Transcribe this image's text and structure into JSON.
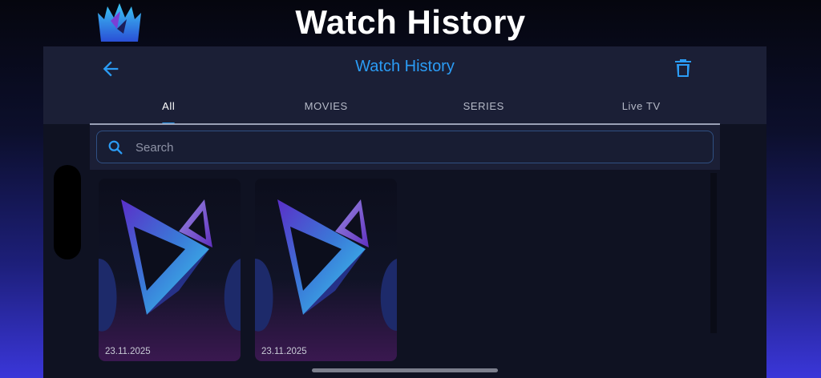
{
  "banner": {
    "title": "Watch History"
  },
  "appbar": {
    "title": "Watch History"
  },
  "tabs": [
    {
      "label": "All",
      "active": true
    },
    {
      "label": "MOVIES",
      "active": false
    },
    {
      "label": "SERIES",
      "active": false
    },
    {
      "label": "Live TV",
      "active": false
    }
  ],
  "search": {
    "placeholder": "Search",
    "value": ""
  },
  "items": [
    {
      "date": "23.11.2025"
    },
    {
      "date": "23.11.2025"
    }
  ],
  "colors": {
    "accent": "#2b9cf5",
    "appbar": "#1b1f36",
    "background": "#0f1222"
  },
  "icons": [
    "crown-logo",
    "back-arrow-icon",
    "trash-icon",
    "search-icon"
  ]
}
